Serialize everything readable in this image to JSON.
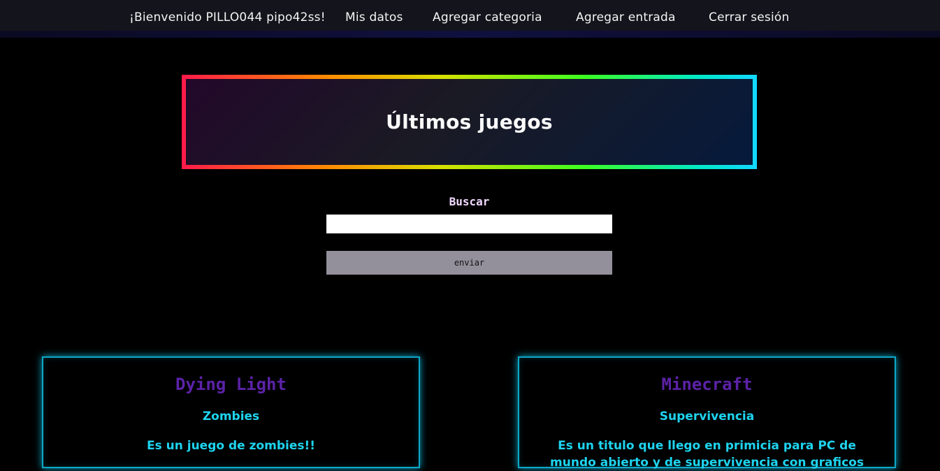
{
  "nav": {
    "welcome": "¡Bienvenido PILLO044 pipo42ss!",
    "mis_datos": "Mis datos",
    "agregar_categoria": "Agregar categoria",
    "agregar_entrada": "Agregar entrada",
    "cerrar_sesion": "Cerrar sesión"
  },
  "hero": {
    "title": "Últimos juegos"
  },
  "search": {
    "label": "Buscar",
    "value": "",
    "button": "enviar"
  },
  "cards": [
    {
      "title": "Dying Light",
      "category": "Zombies",
      "description": "Es un juego de zombies!!"
    },
    {
      "title": "Minecraft",
      "category": "Supervivencia",
      "description": "Es un titulo que llego en primicia para PC de mundo abierto y de supervivencia con graficos"
    }
  ],
  "colors": {
    "card_border": "#0ea7c7",
    "card_title": "#5b22a6",
    "card_text": "#1ed4ef"
  }
}
